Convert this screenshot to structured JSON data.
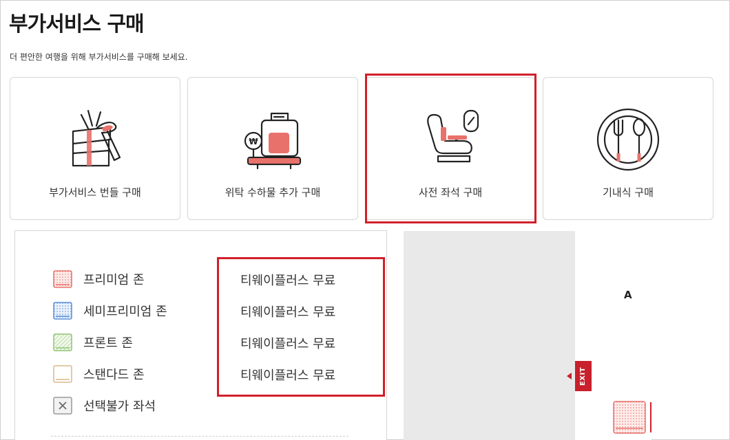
{
  "header": {
    "title": "부가서비스 구매",
    "subtitle": "더 편안한 여행을 위해 부가서비스를 구매해 보세요."
  },
  "cards": [
    {
      "label": "부가서비스 번들 구매",
      "icon": "gift-box-icon"
    },
    {
      "label": "위탁 수하물 추가 구매",
      "icon": "baggage-cart-icon"
    },
    {
      "label": "사전 좌석 구매",
      "icon": "airplane-seat-icon",
      "selected": true
    },
    {
      "label": "기내식 구매",
      "icon": "meal-plate-icon"
    }
  ],
  "legend": {
    "items": [
      {
        "label": "프리미엄 존",
        "price": "티웨이플러스 무료",
        "swatch": "premium-zone-swatch",
        "color": "#e8716b"
      },
      {
        "label": "세미프리미엄 존",
        "price": "티웨이플러스 무료",
        "swatch": "semi-premium-zone-swatch",
        "color": "#5b8fd9"
      },
      {
        "label": "프론트 존",
        "price": "티웨이플러스 무료",
        "swatch": "front-zone-swatch",
        "color": "#8fc46e"
      },
      {
        "label": "스탠다드 존",
        "price": "티웨이플러스 무료",
        "swatch": "standard-zone-swatch",
        "color": "#d8b98a"
      },
      {
        "label": "선택불가 좌석",
        "swatch": "unavailable-seat-swatch",
        "color": "#999999"
      }
    ]
  },
  "seatmap": {
    "column_label": "A",
    "exit_label": "EXIT"
  },
  "colors": {
    "accent": "#d11f2a",
    "icon_red": "#e8716b"
  }
}
